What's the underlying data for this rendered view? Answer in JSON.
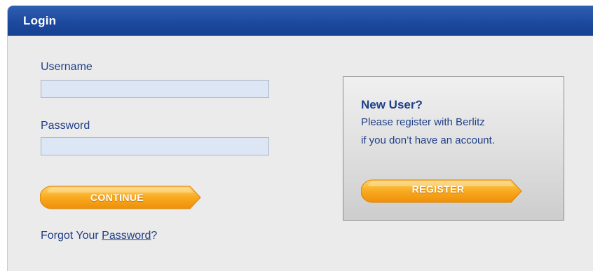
{
  "header": {
    "title": "Login"
  },
  "login_form": {
    "username_label": "Username",
    "username_value": "",
    "password_label": "Password",
    "password_value": "",
    "continue_label": "CONTINUE",
    "forgot_prefix": "Forgot Your ",
    "forgot_link": "Password",
    "forgot_suffix": "?"
  },
  "new_user": {
    "title": "New User?",
    "line1": "Please register with Berlitz",
    "line2": "if you don’t have an account.",
    "register_label": "REGISTER"
  },
  "colors": {
    "header_blue": "#1d4aa0",
    "text_blue": "#1f3f86",
    "button_orange": "#f5a11a",
    "field_bg": "#dde6f4"
  }
}
